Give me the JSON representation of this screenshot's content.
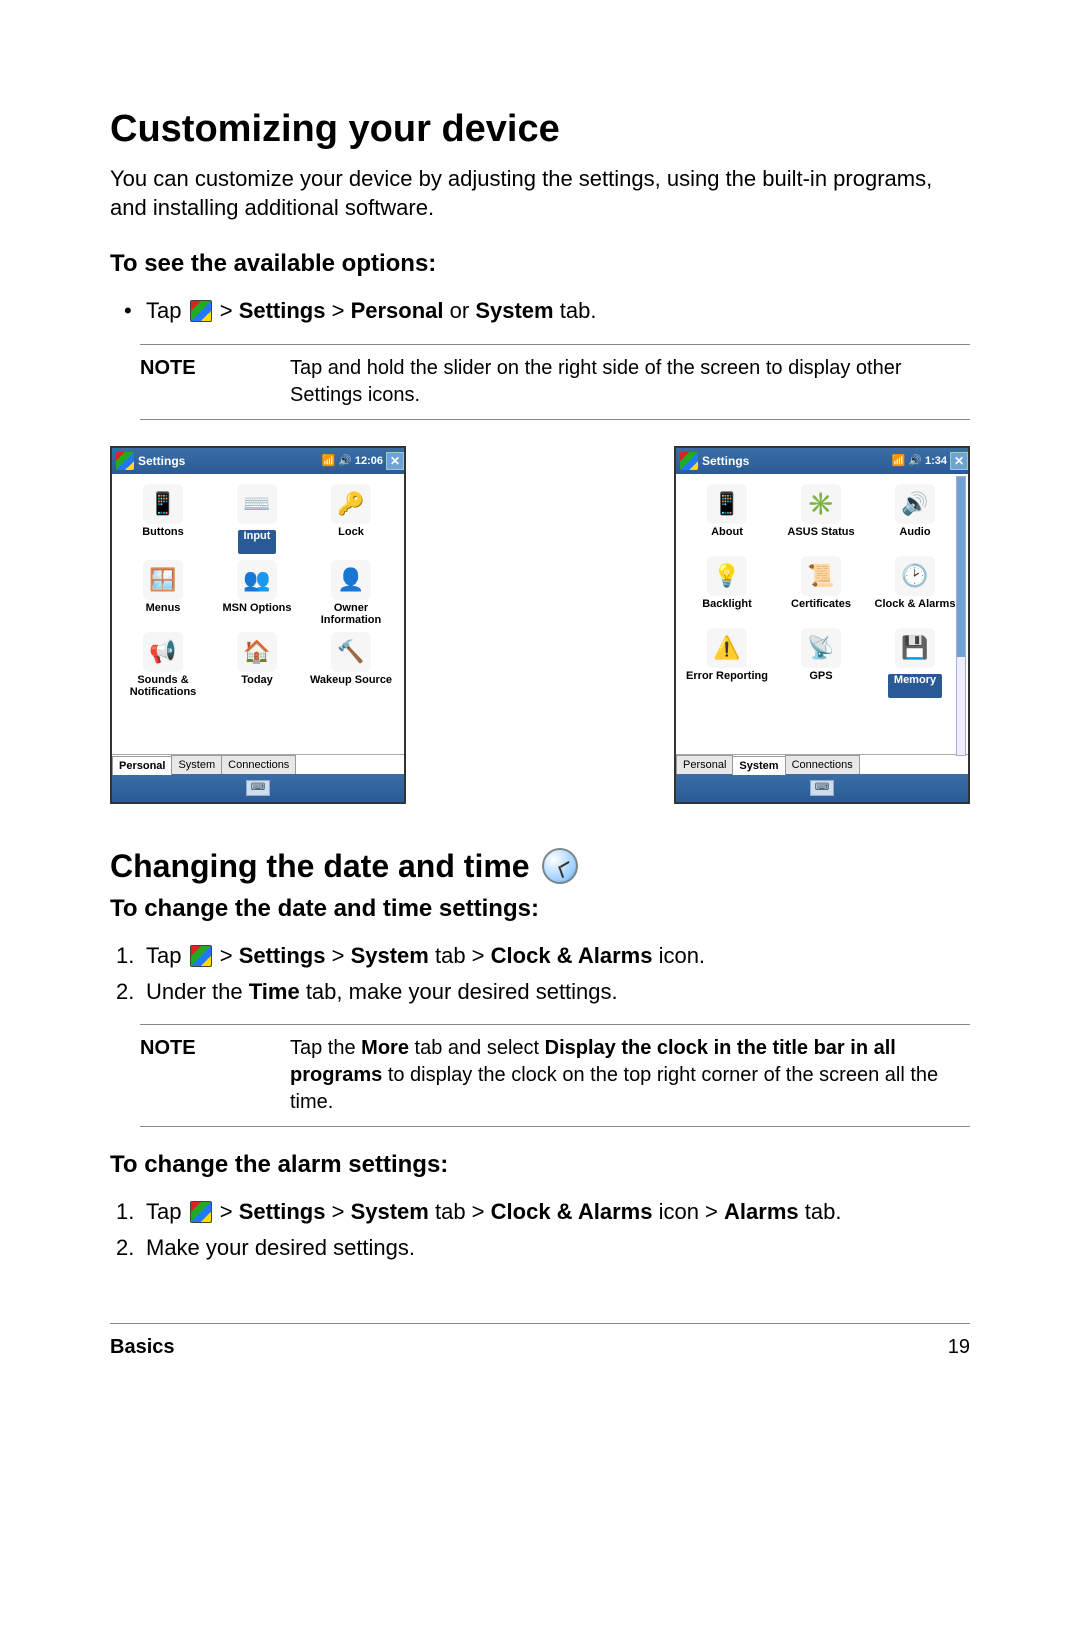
{
  "heading1": "Customizing your device",
  "intro": "You can customize your device by adjusting the settings, using the built-in programs, and installing additional software.",
  "subhead1": "To see the available options:",
  "bullet1_pre": "Tap ",
  "bullet1_mid": " > ",
  "bullet1_b1": "Settings",
  "bullet1_b2": "Personal",
  "bullet1_or": " or ",
  "bullet1_b3": "System",
  "bullet1_post": " tab.",
  "note1_label": "NOTE",
  "note1_text": "Tap and hold the slider on the right side of the screen to display other Settings icons.",
  "screen_title": "Settings",
  "screen_left": {
    "time": "12:06",
    "tabs": [
      "Personal",
      "System",
      "Connections"
    ],
    "active_tab": 0,
    "selected_index": 1,
    "items": [
      {
        "label": "Buttons",
        "emoji": "📱",
        "bg": "#f6f6f6"
      },
      {
        "label": "Input",
        "emoji": "⌨️",
        "bg": "#f6f6f6"
      },
      {
        "label": "Lock",
        "emoji": "🔑",
        "bg": "#f6f6f6"
      },
      {
        "label": "Menus",
        "emoji": "🪟",
        "bg": "#f6f6f6"
      },
      {
        "label": "MSN Options",
        "emoji": "👥",
        "bg": "#f6f6f6"
      },
      {
        "label": "Owner Information",
        "emoji": "👤",
        "bg": "#f6f6f6"
      },
      {
        "label": "Sounds & Notifications",
        "emoji": "📢",
        "bg": "#f6f6f6"
      },
      {
        "label": "Today",
        "emoji": "🏠",
        "bg": "#f6f6f6"
      },
      {
        "label": "Wakeup Source",
        "emoji": "🔨",
        "bg": "#f6f6f6"
      }
    ]
  },
  "screen_right": {
    "time": "1:34",
    "tabs": [
      "Personal",
      "System",
      "Connections"
    ],
    "active_tab": 1,
    "selected_index": 8,
    "items": [
      {
        "label": "About",
        "emoji": "📱",
        "bg": "#f6f6f6"
      },
      {
        "label": "ASUS Status",
        "emoji": "✳️",
        "bg": "#f6f6f6"
      },
      {
        "label": "Audio",
        "emoji": "🔊",
        "bg": "#f6f6f6"
      },
      {
        "label": "Backlight",
        "emoji": "💡",
        "bg": "#f6f6f6"
      },
      {
        "label": "Certificates",
        "emoji": "📜",
        "bg": "#f6f6f6"
      },
      {
        "label": "Clock & Alarms",
        "emoji": "🕑",
        "bg": "#f6f6f6"
      },
      {
        "label": "Error Reporting",
        "emoji": "⚠️",
        "bg": "#f6f6f6"
      },
      {
        "label": "GPS",
        "emoji": "📡",
        "bg": "#f6f6f6"
      },
      {
        "label": "Memory",
        "emoji": "💾",
        "bg": "#f6f6f6"
      }
    ]
  },
  "heading2": "Changing the date and time",
  "subhead2": "To change the date and time settings:",
  "step2a_pre": "Tap ",
  "step2a_b1": "Settings",
  "step2a_b2": "System",
  "step2a_tab": " tab > ",
  "step2a_b3": "Clock & Alarms",
  "step2a_post": " icon.",
  "step2b_pre": "Under the ",
  "step2b_b1": "Time",
  "step2b_post": " tab, make your desired settings.",
  "note2_label": "NOTE",
  "note2_pre": "Tap the ",
  "note2_b1": "More",
  "note2_mid1": " tab and select ",
  "note2_b2": "Display the clock in the title bar in all programs",
  "note2_post": " to display the clock on the top right corner of the screen all the time.",
  "subhead3": "To change the alarm settings:",
  "step3a_pre": "Tap ",
  "step3a_b1": "Settings",
  "step3a_b2": "System",
  "step3a_tab": " tab > ",
  "step3a_b3": "Clock & Alarms",
  "step3a_mid": " icon > ",
  "step3a_b4": "Alarms",
  "step3a_post": " tab.",
  "step3b": "Make your desired settings.",
  "footer_left": "Basics",
  "footer_right": "19"
}
